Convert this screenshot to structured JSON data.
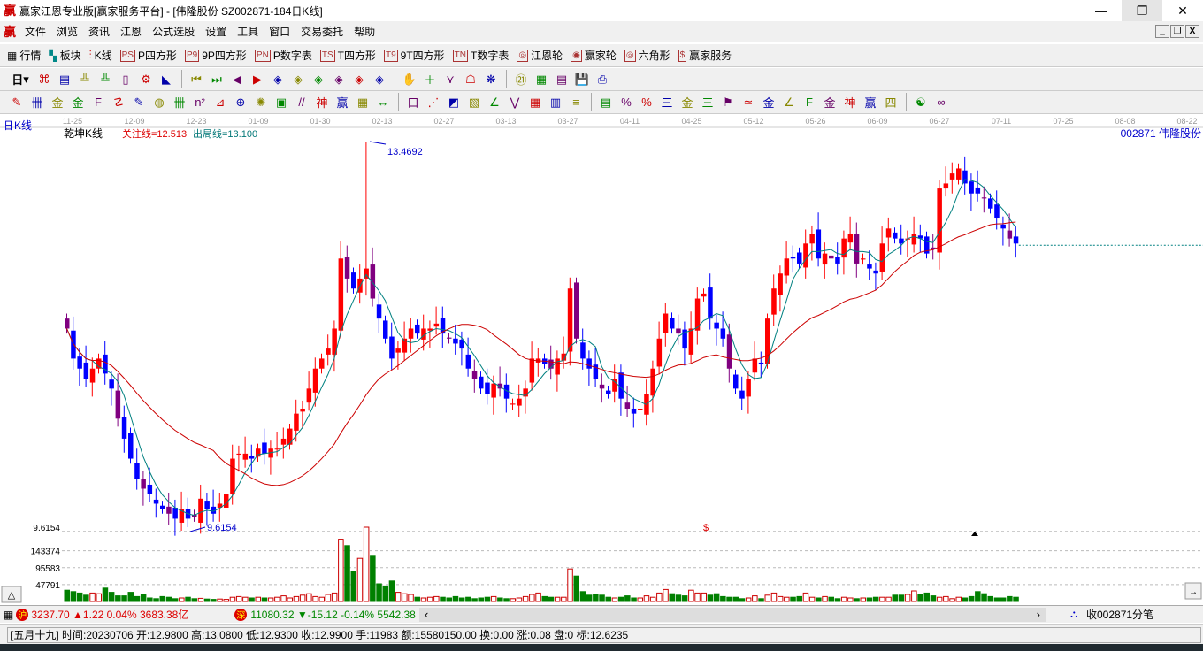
{
  "window": {
    "title": "赢家江恩专业版[赢家服务平台] - [伟隆股份  SZ002871-184日K线]",
    "logo": "赢"
  },
  "menu": [
    "文件",
    "浏览",
    "资讯",
    "江恩",
    "公式选股",
    "设置",
    "工具",
    "窗口",
    "交易委托",
    "帮助"
  ],
  "toolbar1": [
    {
      "icon": "PS",
      "label": "P四方形"
    },
    {
      "icon": "P9",
      "label": "9P四方形"
    },
    {
      "icon": "PN",
      "label": "P数字表"
    },
    {
      "icon": "TS",
      "label": "T四方形"
    },
    {
      "icon": "T9",
      "label": "9T四方形"
    },
    {
      "icon": "TN",
      "label": "T数字表"
    },
    {
      "icon": "◎",
      "label": "江恩轮"
    },
    {
      "icon": "◉",
      "label": "赢家轮"
    },
    {
      "icon": "◎",
      "label": "六角形"
    },
    {
      "icon": "$",
      "label": "赢家服务"
    }
  ],
  "toolbar1_first": [
    {
      "label": "行情"
    },
    {
      "label": "板块"
    },
    {
      "label": "K线"
    }
  ],
  "toolbar2": {
    "period": "日",
    "icons": [
      "⌘",
      "▤",
      "╩",
      "╩",
      "▯",
      "⚙",
      "◣",
      "⏮",
      "⏭",
      "◀",
      "▶",
      "◈",
      "◈",
      "◈",
      "◈",
      "◈",
      "◈",
      "✋",
      "＋",
      "⋎",
      "☖",
      "❋",
      "㉑",
      "▦",
      "▤",
      "💾",
      "⎙"
    ]
  },
  "toolbar3": {
    "icons": [
      "✎",
      "卌",
      "金",
      "金",
      "F",
      "☡",
      "✎",
      "◍",
      "卌",
      "n²",
      "⊿",
      "⊕",
      "✺",
      "▣",
      "//",
      "神",
      "赢",
      "▦",
      "↔",
      "口",
      "⋰",
      "◩",
      "▧",
      "∠",
      "⋁",
      "▦",
      "▥",
      "≡",
      "▤",
      "%",
      "%",
      "三",
      "金",
      "三",
      "⚑",
      "≃",
      "金",
      "∠",
      "F",
      "金",
      "神",
      "赢",
      "四",
      "☯",
      "∞"
    ]
  },
  "chart": {
    "period_label": "日K线",
    "indicator": "乾坤K线",
    "focus_line": "关注线=12.513",
    "exit_line": "出局线=13.100",
    "stock": "002871  伟隆股份",
    "high_label": "13.4692",
    "low_label": "9.6154",
    "price_axis_label": "9.6154",
    "vol_axis": [
      "143374",
      "95583",
      "47791"
    ],
    "dollar_mark": "$",
    "dates": [
      "11-25",
      "12-09",
      "12-23",
      "01-09",
      "01-30",
      "02-13",
      "02-27",
      "03-13",
      "03-27",
      "04-11",
      "04-25",
      "05-12",
      "05-26",
      "06-09",
      "06-27",
      "07-11",
      "07-25",
      "08-08",
      "08-22"
    ],
    "colors": {
      "up": "#ff0000",
      "down": "#0000ff",
      "purple": "#800080",
      "vol_up": "#cc0000",
      "vol_down": "#008000",
      "ma_short": "#008080",
      "ma_long": "#cc0000"
    }
  },
  "chart_data": {
    "type": "candlestick",
    "price_range": [
      9.6154,
      13.4692
    ],
    "high": 13.4692,
    "low": 9.6154,
    "closes": [
      11.6,
      11.3,
      11.2,
      11.1,
      11.2,
      11.3,
      11.15,
      11.0,
      10.7,
      10.5,
      10.3,
      10.1,
      10.0,
      9.95,
      9.85,
      9.8,
      9.75,
      9.7,
      9.8,
      9.7,
      9.72,
      9.9,
      9.8,
      9.75,
      9.85,
      9.95,
      10.3,
      10.35,
      10.35,
      10.3,
      10.4,
      10.35,
      10.4,
      10.4,
      10.5,
      10.6,
      10.75,
      10.8,
      11.0,
      11.2,
      11.3,
      11.4,
      11.6,
      12.3,
      12.1,
      12.0,
      12.1,
      12.2,
      11.9,
      11.7,
      11.5,
      11.3,
      11.4,
      11.5,
      11.6,
      11.55,
      11.6,
      11.6,
      11.65,
      11.55,
      11.5,
      11.45,
      11.4,
      11.2,
      11.1,
      11.0,
      10.95,
      11.05,
      11.0,
      10.9,
      10.85,
      10.9,
      11.0,
      11.3,
      11.3,
      11.25,
      11.2,
      11.3,
      11.35,
      12.0,
      11.5,
      11.3,
      11.2,
      11.1,
      11.0,
      10.95,
      11.1,
      10.9,
      10.8,
      10.75,
      10.8,
      10.95,
      11.2,
      11.5,
      11.75,
      11.6,
      11.55,
      11.4,
      11.6,
      11.9,
      11.95,
      11.7,
      11.6,
      11.5,
      11.2,
      11.0,
      10.9,
      11.1,
      11.3,
      11.25,
      11.7,
      12.0,
      12.15,
      12.3,
      12.3,
      12.25,
      12.45,
      12.55,
      12.3,
      12.35,
      12.3,
      12.25,
      12.5,
      12.55,
      12.25,
      12.3,
      12.2,
      12.15,
      12.45,
      12.6,
      12.5,
      12.45,
      12.5,
      12.55,
      12.5,
      12.35,
      12.4,
      13.0,
      13.05,
      13.15,
      13.2,
      13.05,
      12.95,
      12.95,
      12.9,
      12.8,
      12.7,
      12.6,
      12.5,
      12.45
    ],
    "volumes": [
      32000,
      28000,
      24000,
      18000,
      24000,
      22000,
      38000,
      26000,
      16000,
      16000,
      26000,
      14000,
      20000,
      10000,
      8000,
      14000,
      12000,
      8000,
      10000,
      12000,
      8000,
      9000,
      7000,
      6000,
      7000,
      6000,
      12000,
      14000,
      12000,
      10000,
      12000,
      10000,
      10000,
      12000,
      16000,
      10000,
      14000,
      18000,
      22000,
      14000,
      12000,
      20000,
      24000,
      176000,
      158000,
      84000,
      122000,
      210000,
      128000,
      50000,
      44000,
      58000,
      26000,
      22000,
      20000,
      12000,
      10000,
      12000,
      14000,
      12000,
      10000,
      14000,
      10000,
      12000,
      8000,
      10000,
      12000,
      14000,
      10000,
      8000,
      8000,
      10000,
      14000,
      20000,
      24000,
      14000,
      12000,
      12000,
      12000,
      92000,
      72000,
      28000,
      18000,
      20000,
      18000,
      12000,
      10000,
      12000,
      16000,
      10000,
      10000,
      16000,
      12000,
      24000,
      34000,
      22000,
      18000,
      16000,
      32000,
      24000,
      24000,
      18000,
      22000,
      14000,
      12000,
      12000,
      8000,
      10000,
      16000,
      8000,
      18000,
      24000,
      14000,
      12000,
      12000,
      14000,
      24000,
      12000,
      10000,
      14000,
      12000,
      8000,
      12000,
      10000,
      8000,
      10000,
      10000,
      12000,
      12000,
      12000,
      18000,
      18000,
      20000,
      30000,
      20000,
      24000,
      16000,
      12000,
      14000,
      8000,
      12000,
      10000,
      14000,
      28000,
      22000,
      14000,
      10000,
      10000,
      14000,
      12000,
      10000
    ],
    "vol_ticks": [
      47791,
      95583,
      143374
    ]
  },
  "indexbar": {
    "sh_icon": "沪",
    "sh_value": "3237.70 ▲1.22 0.04% 3683.38亿",
    "sz_icon": "深",
    "sz_value": "11080.32 ▼-15.12 -0.14% 5542.38",
    "recv": "收002871分笔"
  },
  "status": "[五月十九] 时间:20230706 开:12.9800 高:13.0800 低:12.9300 收:12.9900 手:11983 额:15580150.00 换:0.00 涨:0.08 盘:0 标:12.6235"
}
